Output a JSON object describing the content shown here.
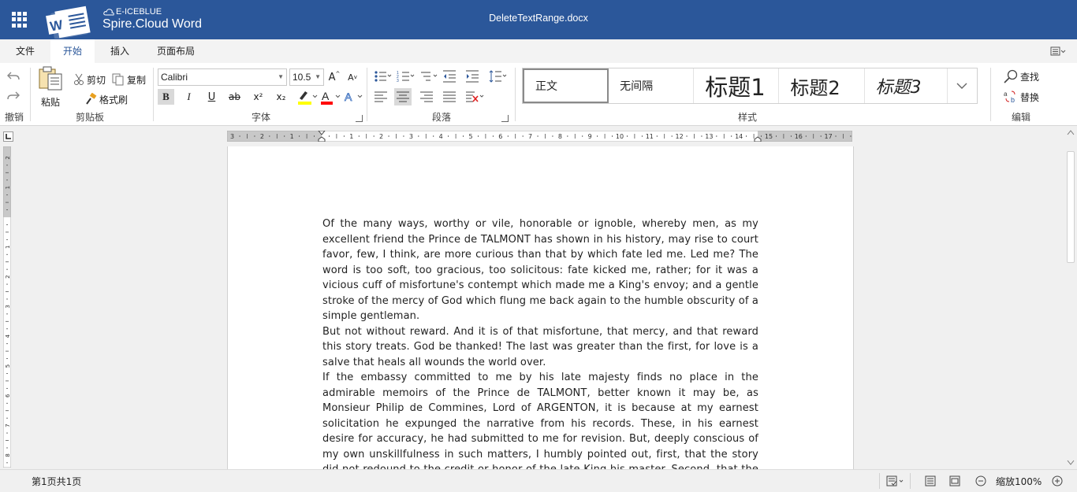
{
  "app": {
    "brand_top": "E-ICEBLUE",
    "brand_name": "Spire.Cloud Word",
    "document_title": "DeleteTextRange.docx"
  },
  "tabs": [
    {
      "label": "文件",
      "active": false
    },
    {
      "label": "开始",
      "active": true
    },
    {
      "label": "插入",
      "active": false
    },
    {
      "label": "页面布局",
      "active": false
    }
  ],
  "ribbon": {
    "undo_group_label": "撤销",
    "clipboard": {
      "paste": "粘贴",
      "cut": "剪切",
      "copy": "复制",
      "format_painter": "格式刷",
      "group_label": "剪贴板"
    },
    "font": {
      "name": "Calibri",
      "size": "10.5",
      "grow": "A",
      "shrink": "A",
      "group_label": "字体"
    },
    "paragraph": {
      "group_label": "段落"
    },
    "styles": {
      "items": [
        "正文",
        "无间隔",
        "标题1",
        "标题2",
        "标题3"
      ],
      "group_label": "样式"
    },
    "editing": {
      "find": "查找",
      "replace": "替换",
      "group_label": "编辑"
    }
  },
  "ruler": {
    "labels": [
      "3",
      "2",
      "1",
      "1",
      "2",
      "3",
      "4",
      "5",
      "6",
      "7",
      "8",
      "9",
      "10",
      "11",
      "12",
      "13",
      "14",
      "15",
      "16",
      "17"
    ]
  },
  "document": {
    "paragraphs": [
      "Of the many ways, worthy or vile, honorable or ignoble, whereby men, as my excellent friend the Prince de TALMONT has shown in his history, may rise to court favor, few, I think, are more curious than that by which fate led me. Led me? The word is too soft, too gracious, too solicitous: fate kicked me, rather; for it was a vicious cuff of misfortune's contempt which made me a King's envoy; and a gentle stroke of the mercy of God which flung me back again to the humble obscurity of a simple gentleman.",
      "But not without reward. And it is of that misfortune, that mercy, and that reward this story treats. God be thanked! The last was greater than the first, for love is a salve that heals all wounds the world over.",
      "If the embassy committed to me by his late majesty finds no place in the admirable memoirs of the Prince de TALMONT, better known it may be, as Monsieur Philip de Commines, Lord of ARGENTON, it is because at my earnest solicitation he expunged the narrative from his records. These, in his earnest desire for accuracy, he had submitted to me for revision. But, deeply conscious of my own unskillfulness in such matters, I humbly pointed out, first, that the story did not redound to the credit or honor of the late King his master. Second, that the disclosure would not possibly"
    ]
  },
  "status": {
    "page_info": "第1页共1页",
    "zoom_label": "缩放100%"
  },
  "colors": {
    "brand": "#2b579a",
    "active_tab_text": "#2b579a",
    "highlight": "#ffff00",
    "font_color": "#ff0000"
  }
}
